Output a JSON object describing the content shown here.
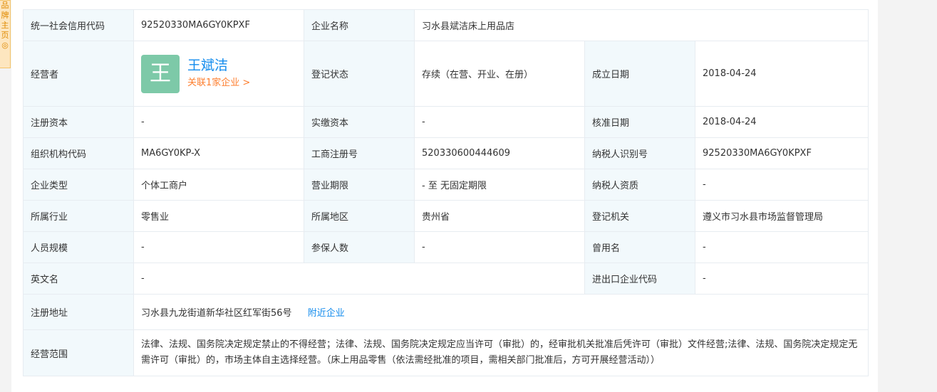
{
  "side_tab": {
    "chars": [
      "品",
      "牌",
      "主",
      "页",
      "◎"
    ]
  },
  "table": {
    "credit_code_label": "统一社会信用代码",
    "credit_code_value": "92520330MA6GY0KPXF",
    "company_name_label": "企业名称",
    "company_name_value": "习水县斌洁床上用品店",
    "operator_label": "经营者",
    "operator_avatar": "王",
    "operator_name": "王斌洁",
    "operator_related": "关联1家企业 >",
    "reg_status_label": "登记状态",
    "reg_status_value": "存续（在营、开业、在册）",
    "founded_label": "成立日期",
    "founded_value": "2018-04-24",
    "reg_capital_label": "注册资本",
    "reg_capital_value": "-",
    "paid_capital_label": "实缴资本",
    "paid_capital_value": "-",
    "approval_date_label": "核准日期",
    "approval_date_value": "2018-04-24",
    "org_code_label": "组织机构代码",
    "org_code_value": "MA6GY0KP-X",
    "biz_reg_no_label": "工商注册号",
    "biz_reg_no_value": "520330600444609",
    "taxpayer_id_label": "纳税人识别号",
    "taxpayer_id_value": "92520330MA6GY0KPXF",
    "company_type_label": "企业类型",
    "company_type_value": "个体工商户",
    "biz_term_label": "营业期限",
    "biz_term_value": "- 至 无固定期限",
    "taxpayer_qual_label": "纳税人资质",
    "taxpayer_qual_value": "-",
    "industry_label": "所属行业",
    "industry_value": "零售业",
    "region_label": "所属地区",
    "region_value": "贵州省",
    "reg_authority_label": "登记机关",
    "reg_authority_value": "遵义市习水县市场监督管理局",
    "staff_size_label": "人员规模",
    "staff_size_value": "-",
    "insured_label": "参保人数",
    "insured_value": "-",
    "former_name_label": "曾用名",
    "former_name_value": "-",
    "english_name_label": "英文名",
    "english_name_value": "-",
    "import_export_label": "进出口企业代码",
    "import_export_value": "-",
    "address_label": "注册地址",
    "address_value": "习水县九龙街道新华社区红军街56号",
    "nearby_link": "附近企业",
    "scope_label": "经营范围",
    "scope_value": "法律、法规、国务院决定规定禁止的不得经营；法律、法规、国务院决定规定应当许可（审批）的，经审批机关批准后凭许可（审批）文件经营;法律、法规、国务院决定规定无需许可（审批）的，市场主体自主选择经营。（床上用品零售（依法需经批准的项目，需相关部门批准后，方可开展经营活动））"
  }
}
